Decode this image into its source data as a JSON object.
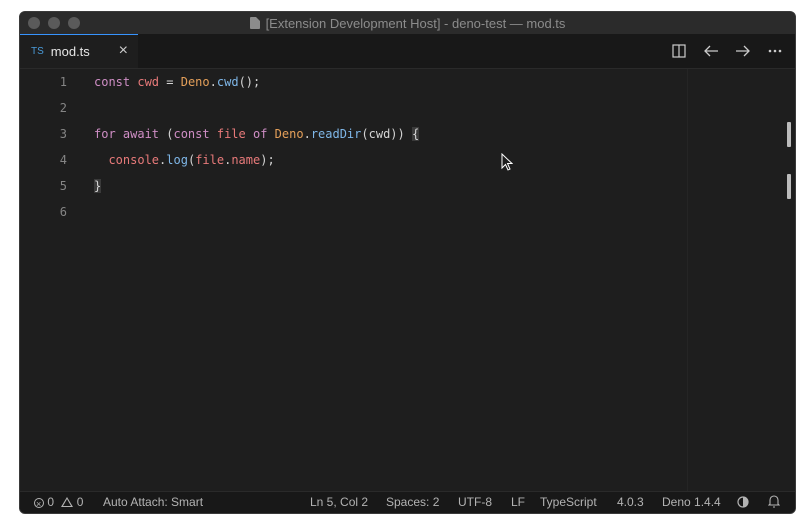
{
  "window": {
    "title": "[Extension Development Host] - deno-test — mod.ts"
  },
  "tab": {
    "lang": "TS",
    "filename": "mod.ts",
    "close_glyph": "×"
  },
  "tab_actions": {
    "icons": [
      "split-editor-icon",
      "arrow-left-icon",
      "arrow-right-icon",
      "more-icon"
    ]
  },
  "editor": {
    "line_numbers": [
      "1",
      "2",
      "3",
      "4",
      "5",
      "6"
    ],
    "lines": [
      "const cwd = Deno.cwd();",
      "",
      "for await (const file of Deno.readDir(cwd)) {",
      "  console.log(file.name);",
      "}",
      ""
    ]
  },
  "statusbar": {
    "errors": "0",
    "warnings": "0",
    "auto_attach": "Auto Attach: Smart",
    "position": "Ln 5, Col 2",
    "spaces": "Spaces: 2",
    "encoding": "UTF-8",
    "eol": "LF",
    "language": "TypeScript",
    "ts_version": "4.0.3",
    "deno_version": "Deno 1.4.4"
  },
  "colors": {
    "accent": "#3794ff",
    "keyword": "#cf8ec5",
    "class": "#e5a05a",
    "function": "#7fb7e8",
    "variable": "#e87a7a"
  }
}
